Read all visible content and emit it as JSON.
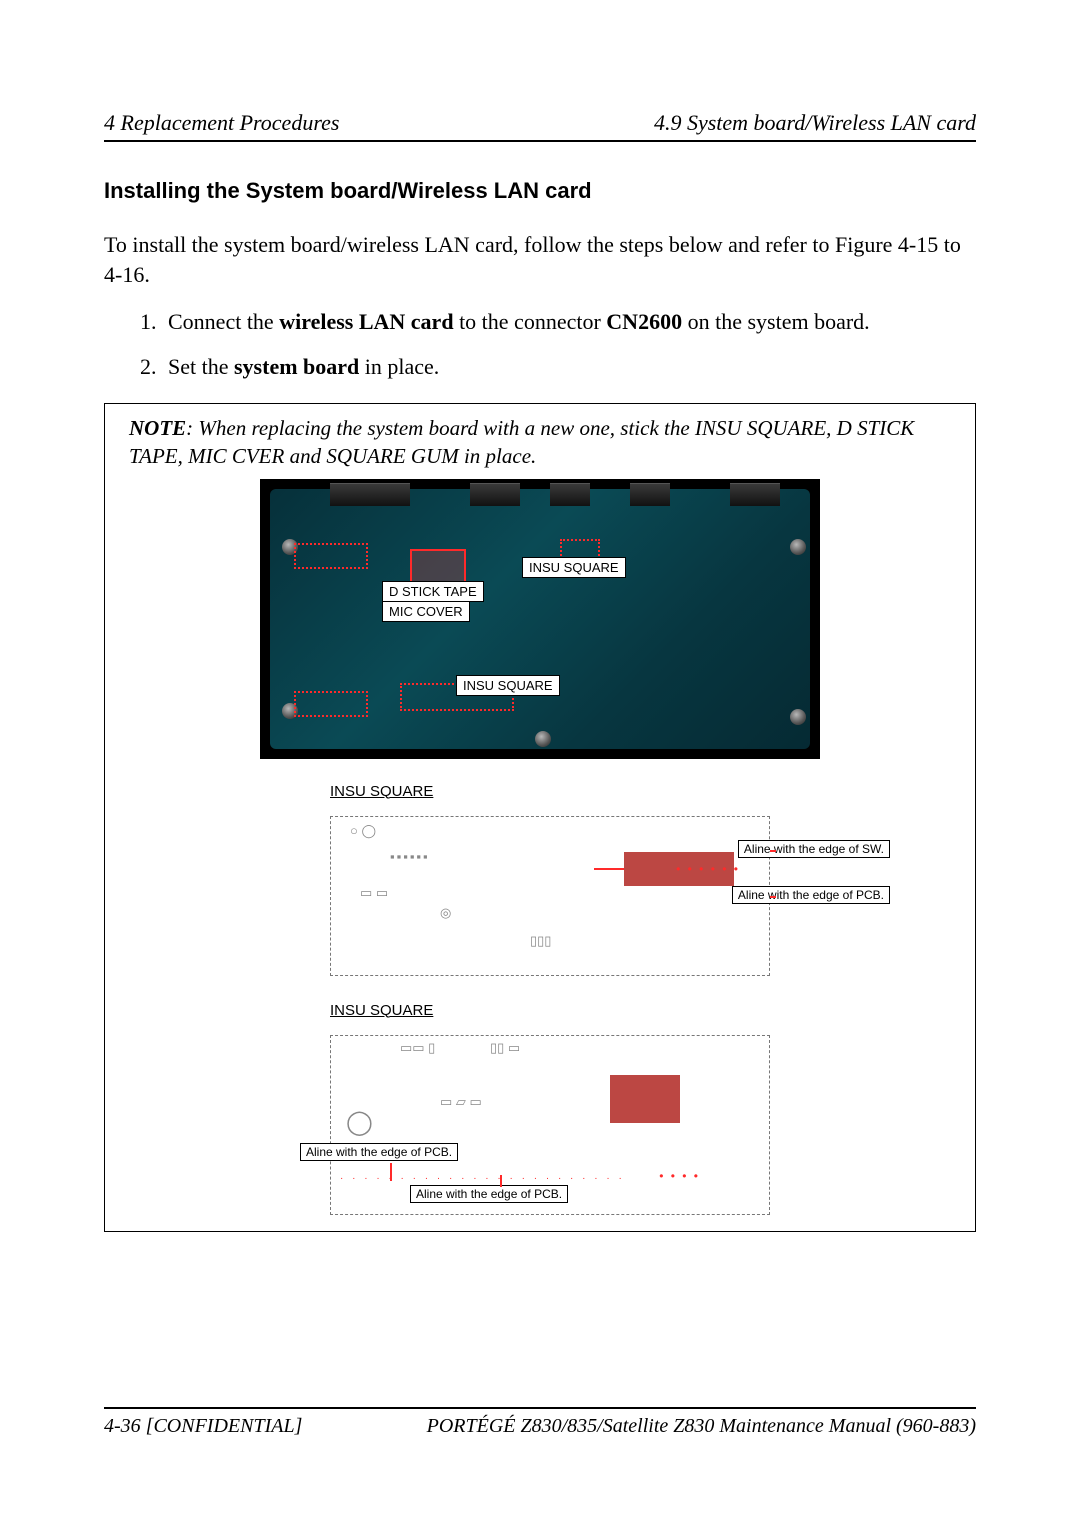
{
  "header": {
    "left": "4 Replacement Procedures",
    "right": "4.9  System board/Wireless LAN card"
  },
  "section_heading": "Installing the System board/Wireless LAN card",
  "intro_text": "To install the system board/wireless LAN card, follow the steps below and refer to Figure 4-15 to 4-16.",
  "steps": [
    {
      "pre": "Connect the ",
      "b1": "wireless LAN card",
      "mid": " to the connector ",
      "b2": "CN2600",
      "post": " on the system board."
    },
    {
      "pre": "Set the ",
      "b1": "system board",
      "mid": " in place.",
      "b2": "",
      "post": ""
    }
  ],
  "note": {
    "label": "NOTE",
    "text": ": When replacing the system board with a new one, stick the INSU SQUARE, D STICK TAPE, MIC CVER and SQUARE GUM in place."
  },
  "photo_labels": {
    "insu_square_1": "INSU SQUARE",
    "d_stick_tape": "D STICK TAPE",
    "mic_cover": "MIC COVER",
    "insu_square_2": "INSU SQUARE"
  },
  "schem1": {
    "title": "INSU SQUARE",
    "label_sw": "Aline with the edge of SW.",
    "label_pcb": "Aline with the edge of PCB."
  },
  "schem2": {
    "title": "INSU SQUARE",
    "label_pcb_left": "Aline with the edge of PCB.",
    "label_pcb_bottom": "Aline with the edge of PCB."
  },
  "footer": {
    "left": "4-36      [CONFIDENTIAL]",
    "right": "PORTÉGÉ Z830/835/Satellite Z830 Maintenance Manual (960-883)"
  }
}
